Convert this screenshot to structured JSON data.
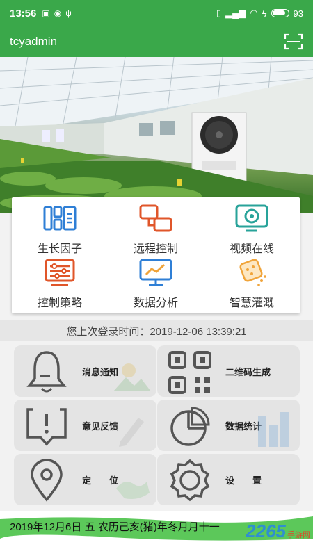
{
  "status": {
    "time": "13:56",
    "battery": "93"
  },
  "appbar": {
    "title": "tcyadmin"
  },
  "menu": [
    {
      "label": "生长因子",
      "icon": "growth-factor-icon",
      "color": "#2f7fd6"
    },
    {
      "label": "远程控制",
      "icon": "remote-control-icon",
      "color": "#e0562a"
    },
    {
      "label": "视频在线",
      "icon": "video-online-icon",
      "color": "#28a39a"
    },
    {
      "label": "控制策略",
      "icon": "control-strategy-icon",
      "color": "#e0562a"
    },
    {
      "label": "数据分析",
      "icon": "data-analysis-icon",
      "color": "#2f7fd6"
    },
    {
      "label": "智慧灌溉",
      "icon": "smart-irrigation-icon",
      "color": "#f0a43a"
    }
  ],
  "login": {
    "text": "您上次登录时间：2019-12-06 13:39:21"
  },
  "tiles": [
    {
      "label": "消息通知",
      "icon": "bell-icon"
    },
    {
      "label": "二维码生成",
      "icon": "qr-code-icon"
    },
    {
      "label": "意见反馈",
      "icon": "feedback-icon"
    },
    {
      "label": "数据统计",
      "icon": "pie-chart-icon"
    },
    {
      "label": "定　　位",
      "icon": "location-pin-icon"
    },
    {
      "label": "设　　置",
      "icon": "settings-gear-icon"
    }
  ],
  "footer": {
    "date": "2019年12月6日 五 农历己亥(猪)年冬月月十一",
    "brand_num": "2265",
    "brand_sub": "手游网"
  },
  "colors": {
    "primary_green": "#3aa84a",
    "tile_bg": "#e4e4e4"
  }
}
